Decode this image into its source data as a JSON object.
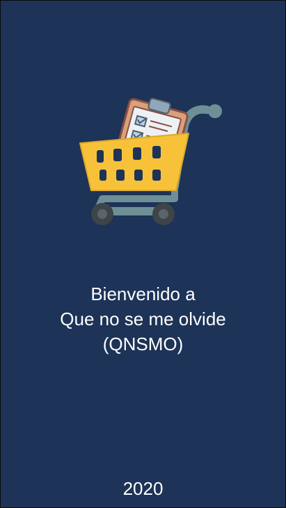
{
  "splash": {
    "logo_icon": "shopping-cart-with-checklist-icon",
    "welcome_line1": "Bienvenido a",
    "welcome_line2": "Que no se me olvide",
    "welcome_line3": "(QNSMO)",
    "year": "2020"
  },
  "colors": {
    "background": "#1d3357",
    "text": "#ffffff",
    "cart_basket": "#f7c23a",
    "cart_frame": "#6f8f96",
    "wheel": "#3e4448",
    "clipboard": "#d9a07a",
    "paper": "#eef1f4",
    "check": "#5b7fa0"
  }
}
